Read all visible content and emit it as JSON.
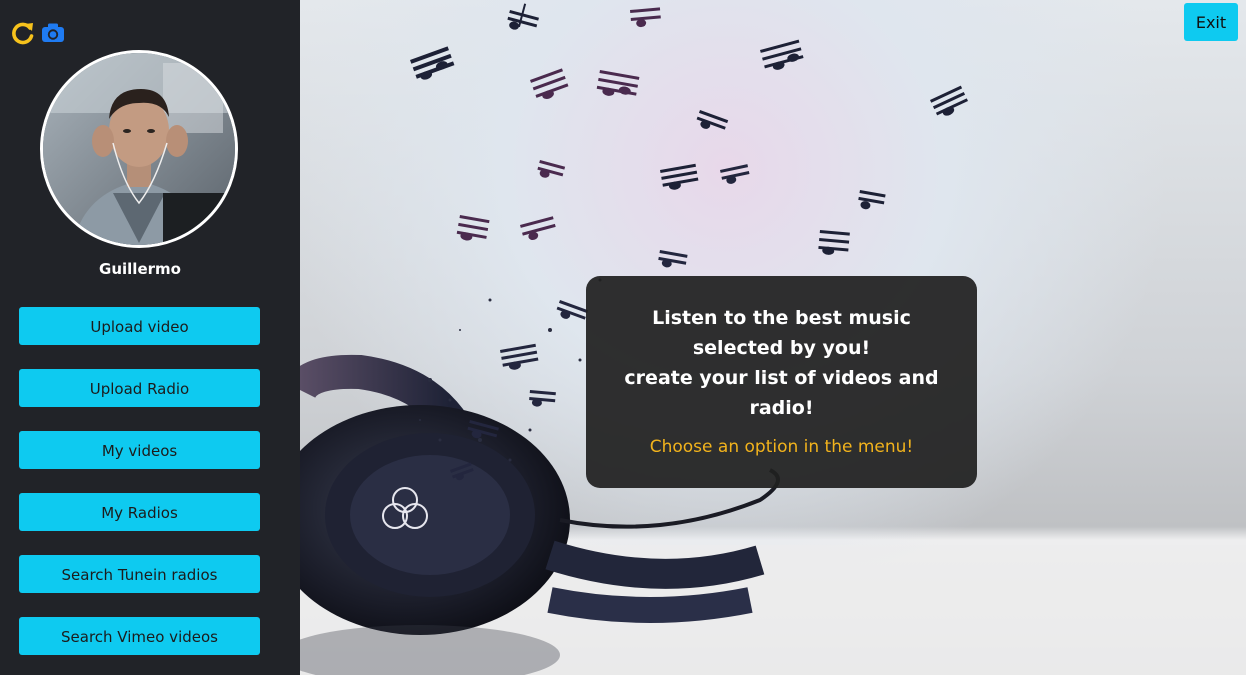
{
  "sidebar": {
    "icons": {
      "refresh": "refresh-icon",
      "camera": "camera-icon"
    },
    "username": "Guillermo",
    "menu": [
      {
        "label": "Upload video"
      },
      {
        "label": "Upload Radio"
      },
      {
        "label": "My videos"
      },
      {
        "label": "My Radios"
      },
      {
        "label": "Search Tunein radios"
      },
      {
        "label": "Search Vimeo videos"
      }
    ]
  },
  "header": {
    "exit_label": "Exit"
  },
  "card": {
    "line1": "Listen to the best music",
    "line2": "selected by you!",
    "line3": "create your list of videos and",
    "line4": "radio!",
    "cta": "Choose an option in the menu!"
  },
  "colors": {
    "sidebar_bg": "#212328",
    "button_bg": "#0ecaf0",
    "cta_text": "#f2b31c",
    "refresh_icon": "#f6c21c",
    "camera_icon": "#1f7bf2"
  }
}
